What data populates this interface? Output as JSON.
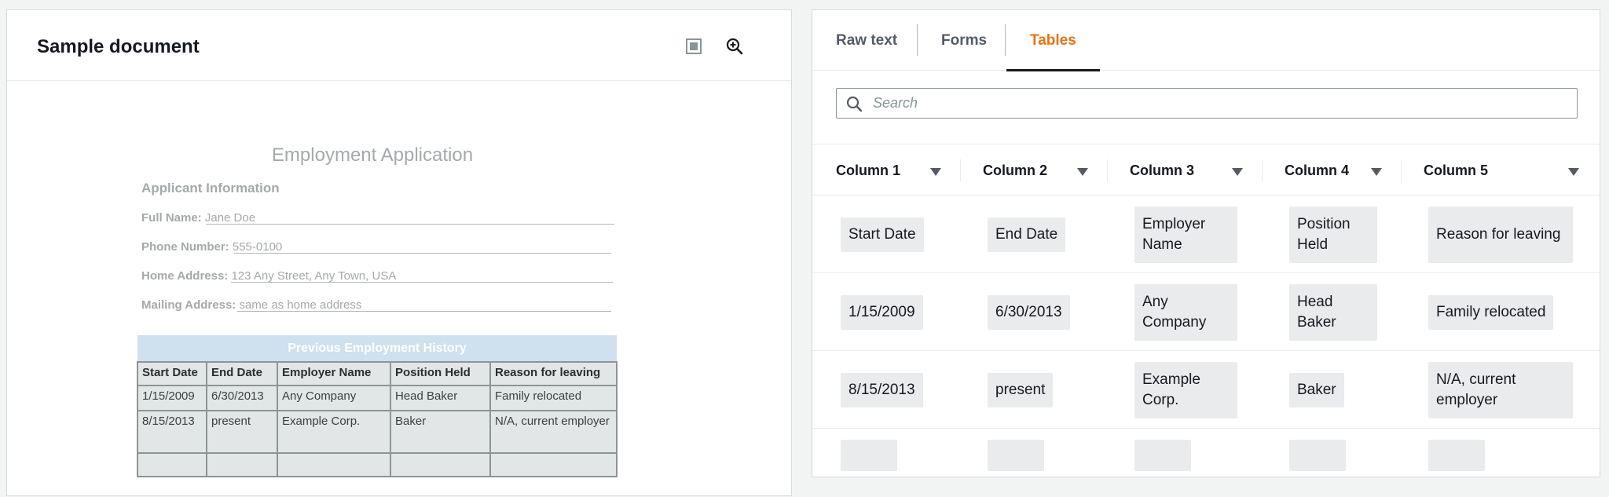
{
  "left_panel": {
    "title": "Sample document",
    "icons": [
      "fit-page-icon",
      "zoom-in-icon"
    ],
    "document": {
      "title": "Employment Application",
      "section": "Applicant Information",
      "fields": [
        {
          "label": "Full Name:",
          "value": "Jane Doe"
        },
        {
          "label": "Phone Number:",
          "value": "555-0100"
        },
        {
          "label": "Home Address:",
          "value": "123 Any Street, Any Town, USA"
        },
        {
          "label": "Mailing Address:",
          "value": "same as home address"
        }
      ],
      "table": {
        "caption": "Previous Employment History",
        "headers": [
          "Start Date",
          "End Date",
          "Employer Name",
          "Position Held",
          "Reason for leaving"
        ],
        "rows": [
          [
            "1/15/2009",
            "6/30/2013",
            "Any Company",
            "Head Baker",
            "Family relocated"
          ],
          [
            "8/15/2013",
            "present",
            "Example Corp.",
            "Baker",
            "N/A, current employer"
          ],
          [
            "",
            "",
            "",
            "",
            ""
          ]
        ]
      }
    }
  },
  "right_panel": {
    "tabs": [
      {
        "label": "Raw text",
        "active": false
      },
      {
        "label": "Forms",
        "active": false
      },
      {
        "label": "Tables",
        "active": true
      }
    ],
    "search": {
      "placeholder": "Search",
      "value": ""
    },
    "columns": [
      "Column 1",
      "Column 2",
      "Column 3",
      "Column 4",
      "Column 5"
    ],
    "rows": [
      [
        "Start Date",
        "End Date",
        "Employer Name",
        "Position Held",
        "Reason for leaving"
      ],
      [
        "1/15/2009",
        "6/30/2013",
        "Any Company",
        "Head Baker",
        "Family relocated"
      ],
      [
        "8/15/2013",
        "present",
        "Example Corp.",
        "Baker",
        "N/A, current employer"
      ],
      [
        "",
        "",
        "",
        "",
        ""
      ]
    ]
  },
  "colors": {
    "accent": "#ec7211",
    "chip": "#e9ebed",
    "table_caption": "#cfe0ef"
  }
}
